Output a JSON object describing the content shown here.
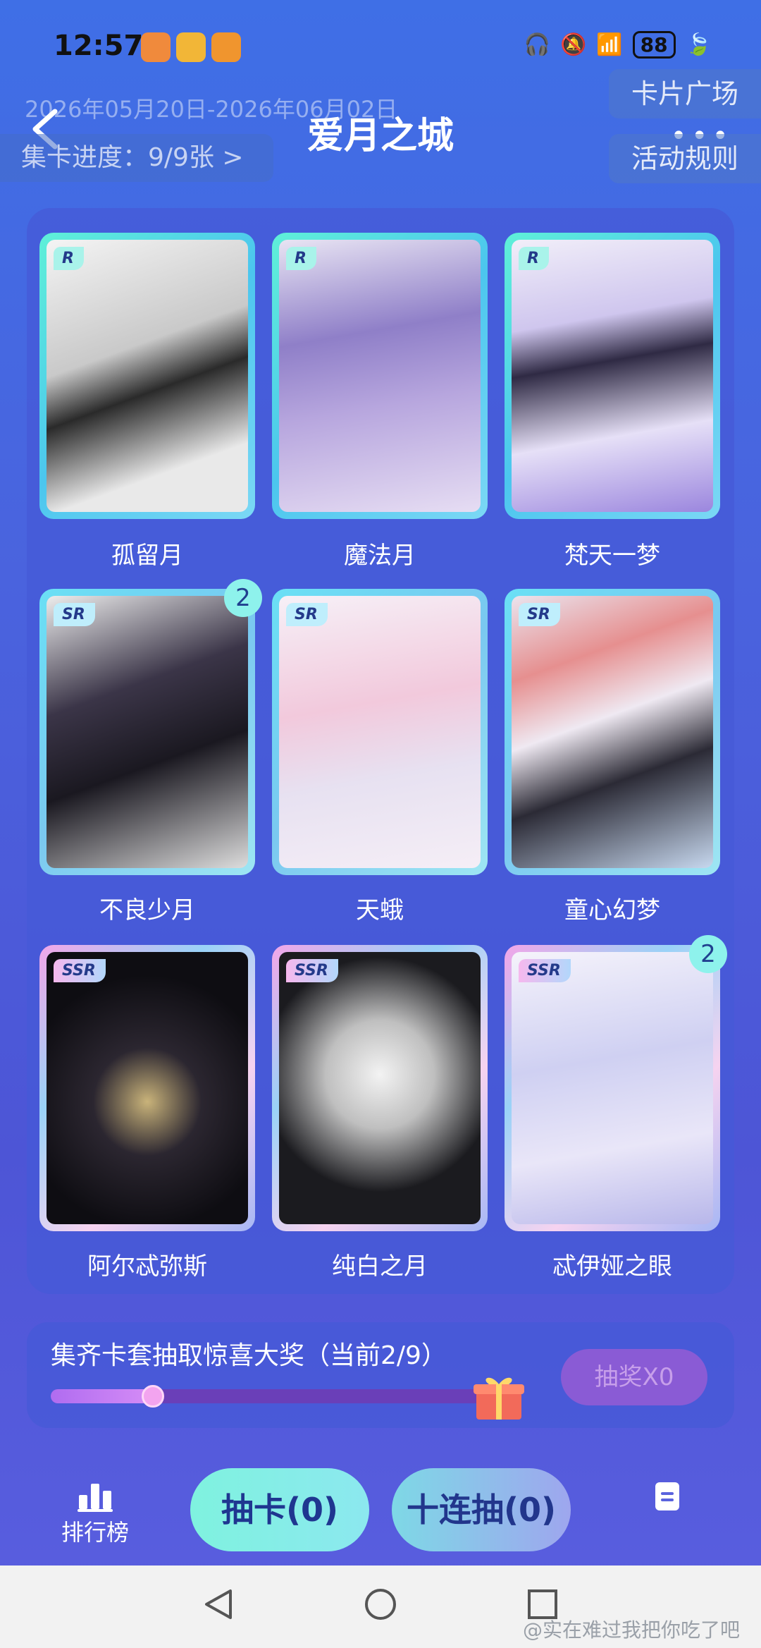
{
  "status_bar": {
    "time": "12:57",
    "battery": "88"
  },
  "header": {
    "date_range": "2026年05月20日-2026年06月02日",
    "title": "爱月之城",
    "progress": "集卡进度：9/9张 >",
    "card_square": "卡片广场",
    "more": "•••",
    "rules": "活动规则"
  },
  "cards": [
    {
      "rarity": "R",
      "name": "孤留月",
      "count": ""
    },
    {
      "rarity": "R",
      "name": "魔法月",
      "count": ""
    },
    {
      "rarity": "R",
      "name": "梵天一梦",
      "count": ""
    },
    {
      "rarity": "SR",
      "name": "不良少月",
      "count": "2"
    },
    {
      "rarity": "SR",
      "name": "天蛾",
      "count": ""
    },
    {
      "rarity": "SR",
      "name": "童心幻梦",
      "count": ""
    },
    {
      "rarity": "SSR",
      "name": "阿尔忒弥斯",
      "count": ""
    },
    {
      "rarity": "SSR",
      "name": "纯白之月",
      "count": ""
    },
    {
      "rarity": "SSR",
      "name": "忒伊娅之眼",
      "count": "2"
    }
  ],
  "prize": {
    "text": "集齐卡套抽取惊喜大奖（当前2/9）",
    "progress": 0.22,
    "draw_label": "抽奖X0"
  },
  "bottom": {
    "rank_label": "排行榜",
    "draw_one": "抽卡(0)",
    "draw_ten": "十连抽(0)"
  },
  "watermark": "@实在难过我把你吃了吧",
  "colors": {
    "accent": "#7ff2df",
    "background": "#4a63de"
  }
}
